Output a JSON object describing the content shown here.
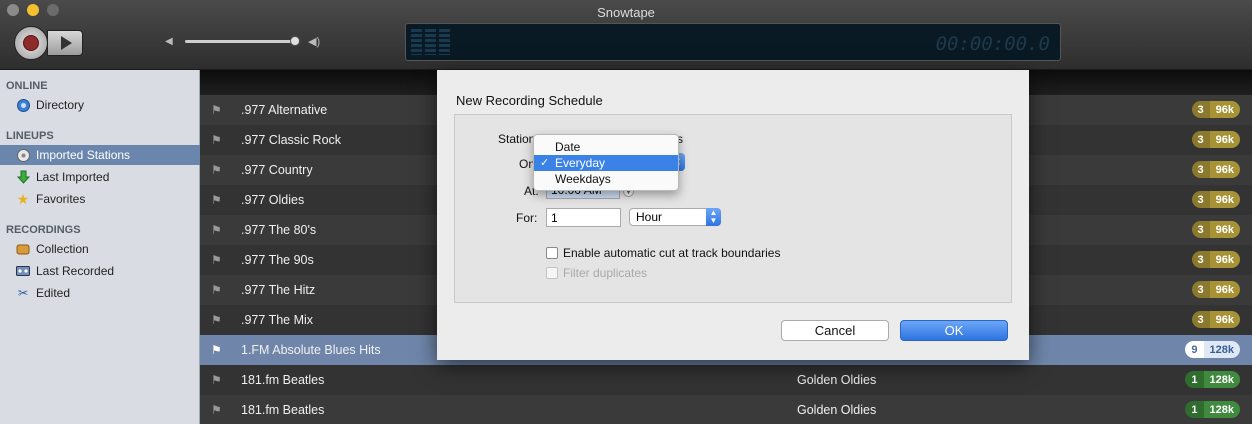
{
  "window": {
    "title": "Snowtape"
  },
  "toolbar": {
    "time_display": "00:00:00.0"
  },
  "sidebar": {
    "sections": [
      {
        "title": "ONLINE",
        "items": [
          {
            "label": "Directory",
            "icon": "globe-icon"
          }
        ]
      },
      {
        "title": "LINEUPS",
        "items": [
          {
            "label": "Imported Stations",
            "icon": "import-icon",
            "selected": true
          },
          {
            "label": "Last Imported",
            "icon": "arrow-down-icon"
          },
          {
            "label": "Favorites",
            "icon": "star-icon"
          }
        ]
      },
      {
        "title": "RECORDINGS",
        "items": [
          {
            "label": "Collection",
            "icon": "box-icon"
          },
          {
            "label": "Last Recorded",
            "icon": "tape-icon"
          },
          {
            "label": "Edited",
            "icon": "scissors-icon"
          }
        ]
      }
    ]
  },
  "stations": [
    {
      "name": ".977 Alternative",
      "genre": "",
      "count": "3",
      "bitrate": "96k"
    },
    {
      "name": ".977 Classic Rock",
      "genre": "",
      "count": "3",
      "bitrate": "96k"
    },
    {
      "name": ".977 Country",
      "genre": "",
      "count": "3",
      "bitrate": "96k"
    },
    {
      "name": ".977 Oldies",
      "genre": "",
      "count": "3",
      "bitrate": "96k"
    },
    {
      "name": ".977 The 80's",
      "genre": "",
      "count": "3",
      "bitrate": "96k"
    },
    {
      "name": ".977 The 90s",
      "genre": "",
      "count": "3",
      "bitrate": "96k"
    },
    {
      "name": ".977 The Hitz",
      "genre": "",
      "count": "3",
      "bitrate": "96k"
    },
    {
      "name": ".977 The Mix",
      "genre": "",
      "count": "3",
      "bitrate": "96k"
    },
    {
      "name": "1.FM Absolute Blues Hits",
      "genre": "",
      "count": "9",
      "bitrate": "128k",
      "selected": true
    },
    {
      "name": "181.fm Beatles",
      "genre": "Golden Oldies",
      "count": "1",
      "bitrate": "128k"
    },
    {
      "name": "181.fm Beatles",
      "genre": "Golden Oldies",
      "count": "1",
      "bitrate": "128k"
    }
  ],
  "dialog": {
    "title": "New Recording Schedule",
    "station_label": "Station",
    "station_value_tail": "s",
    "on_label": "On",
    "at_label": "At:",
    "at_value": "10:00 AM",
    "for_label": "For:",
    "for_value": "1",
    "unit_value": "Hour",
    "checkbox_autocut": "Enable automatic cut at track boundaries",
    "checkbox_duplicates": "Filter duplicates",
    "cancel_label": "Cancel",
    "ok_label": "OK"
  },
  "menu": {
    "items": [
      {
        "label": "Date",
        "checked": false
      },
      {
        "label": "Everyday",
        "checked": true
      },
      {
        "label": "Weekdays",
        "checked": false
      }
    ],
    "check_glyph": "✓"
  },
  "colors": {
    "badge_gold": "#8b7a2e",
    "badge_green": "#2f6d2f",
    "selection": "#6f86aa",
    "accent": "#3b82e6"
  }
}
